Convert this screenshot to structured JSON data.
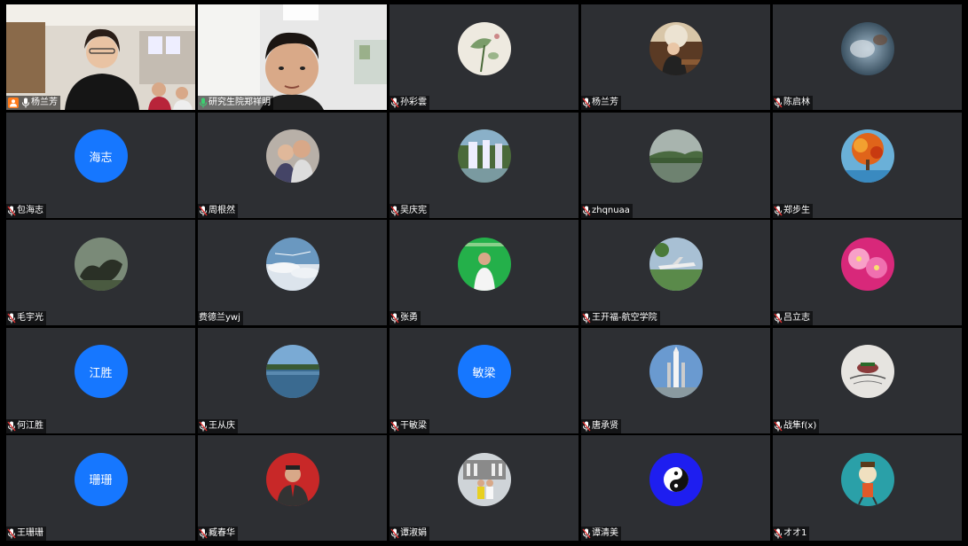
{
  "participants": [
    {
      "name": "杨兰芳",
      "type": "video",
      "host": true,
      "mic": "on"
    },
    {
      "name": "研究生院郑祥明",
      "type": "video",
      "active": true,
      "mic": "speaking"
    },
    {
      "name": "孙彩雲",
      "type": "photo",
      "photo": "lotus-painting",
      "mic": "muted"
    },
    {
      "name": "杨兰芳",
      "type": "photo",
      "photo": "woman-portrait",
      "mic": "muted"
    },
    {
      "name": "陈启林",
      "type": "photo",
      "photo": "blurred-photo",
      "mic": "muted"
    },
    {
      "name": "包海志",
      "type": "initials",
      "initials": "海志",
      "mic": "muted"
    },
    {
      "name": "周根然",
      "type": "photo",
      "photo": "two-people",
      "mic": "muted"
    },
    {
      "name": "吴庆宪",
      "type": "photo",
      "photo": "waterfall",
      "mic": "muted"
    },
    {
      "name": "zhqnuaa",
      "type": "photo",
      "photo": "lake-landscape",
      "mic": "muted"
    },
    {
      "name": "郑步生",
      "type": "photo",
      "photo": "autumn-tree",
      "mic": "muted"
    },
    {
      "name": "毛宇光",
      "type": "photo",
      "photo": "dark-sculpture",
      "mic": "muted"
    },
    {
      "name": "费德兰ywj",
      "type": "photo",
      "photo": "sky-clouds",
      "mic": "none"
    },
    {
      "name": "张勇",
      "type": "photo",
      "photo": "man-green-bg",
      "mic": "muted"
    },
    {
      "name": "王开福-航空学院",
      "type": "photo",
      "photo": "airplane",
      "mic": "muted"
    },
    {
      "name": "吕立志",
      "type": "photo",
      "photo": "pink-flowers",
      "mic": "muted"
    },
    {
      "name": "何江胜",
      "type": "initials",
      "initials": "江胜",
      "mic": "muted"
    },
    {
      "name": "王从庆",
      "type": "photo",
      "photo": "lake-sky",
      "mic": "muted"
    },
    {
      "name": "干敏梁",
      "type": "initials",
      "initials": "敏梁",
      "mic": "muted"
    },
    {
      "name": "唐承贤",
      "type": "photo",
      "photo": "rocket",
      "mic": "muted"
    },
    {
      "name": "战隼f(x)",
      "type": "photo",
      "photo": "sketch",
      "mic": "muted"
    },
    {
      "name": "王珊珊",
      "type": "initials",
      "initials": "珊珊",
      "mic": "muted"
    },
    {
      "name": "臧春华",
      "type": "photo",
      "photo": "man-red-bg",
      "mic": "muted"
    },
    {
      "name": "谭淑娟",
      "type": "photo",
      "photo": "tourists-building",
      "mic": "muted"
    },
    {
      "name": "谭清美",
      "type": "photo",
      "photo": "yin-yang",
      "mic": "muted"
    },
    {
      "name": "オオ1",
      "type": "photo",
      "photo": "cartoon-figure",
      "mic": "muted"
    }
  ],
  "colors": {
    "tile_bg": "#2d2f33",
    "initials_bg": "#1677ff",
    "active_border": "#2fbf71",
    "host_badge": "#ff7a1a"
  }
}
